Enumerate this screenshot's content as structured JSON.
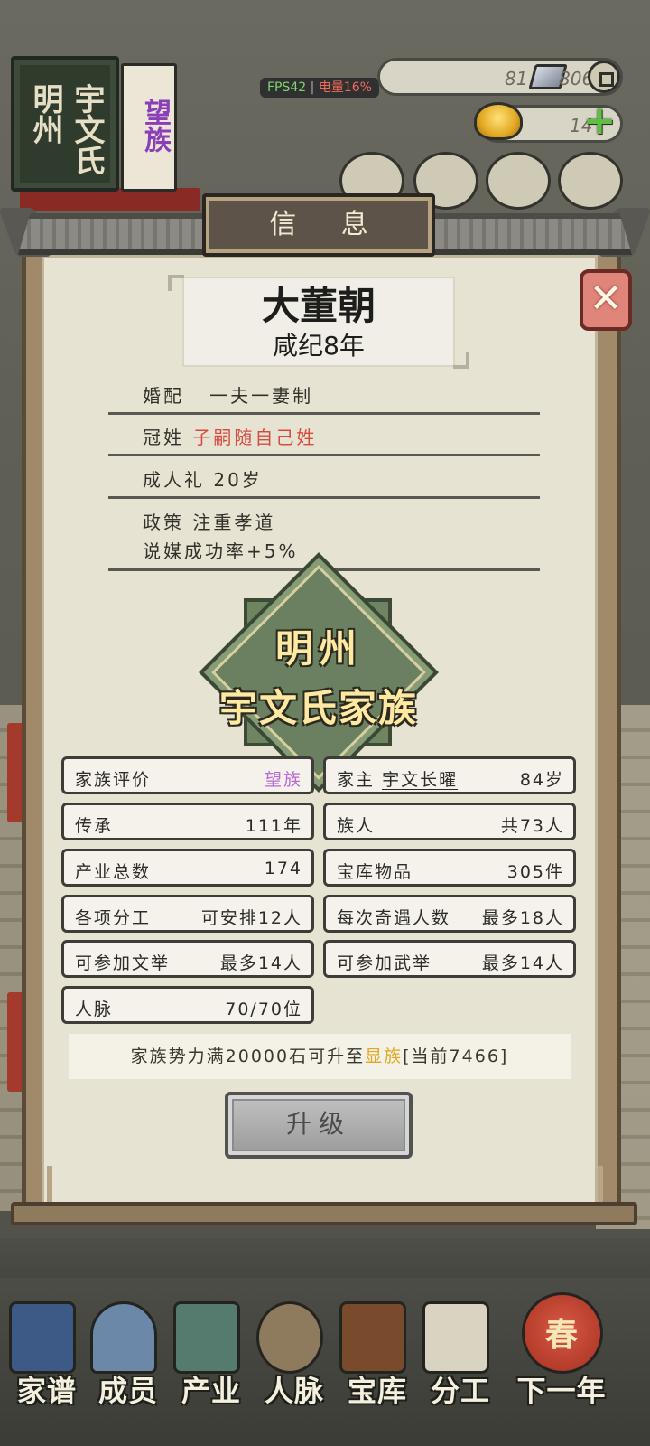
{
  "hud": {
    "book": {
      "col1": "明州",
      "col2": "宇文氏",
      "tag": "望族"
    },
    "fps": "FPS42",
    "battery": "电量16%",
    "silver": "81",
    "coins": "806",
    "gold": "14"
  },
  "panel": {
    "title": "信 息",
    "close_label": "✕",
    "dynasty": "大董朝",
    "year": "咸纪8年",
    "rules": [
      {
        "label": "婚配",
        "value": "一夫一妻制"
      },
      {
        "label": "冠姓",
        "value": "子嗣随自己姓"
      },
      {
        "label": "成人礼",
        "value": "20岁"
      },
      {
        "label": "政策",
        "value": "注重孝道",
        "extra": "说媒成功率+5%"
      }
    ],
    "emblem": {
      "line1": "明州",
      "line2": "宇文氏家族"
    },
    "stats": {
      "rating": {
        "label": "家族评价",
        "value": "望族"
      },
      "head": {
        "label": "家主",
        "name": "宇文长曜",
        "value": "84岁"
      },
      "heritage": {
        "label": "传承",
        "value": "111年"
      },
      "members": {
        "label": "族人",
        "value": "共73人"
      },
      "industry": {
        "label": "产业总数",
        "value": "174"
      },
      "treasury": {
        "label": "宝库物品",
        "value": "305件"
      },
      "division": {
        "label": "各项分工",
        "value": "可安排12人"
      },
      "encounter": {
        "label": "每次奇遇人数",
        "value": "最多18人"
      },
      "civil_exam": {
        "label": "可参加文举",
        "value": "最多14人"
      },
      "military_exam": {
        "label": "可参加武举",
        "value": "最多14人"
      },
      "connections": {
        "label": "人脉",
        "value": "70/70位"
      }
    },
    "note": {
      "pre": "家族势力满20000石可升至",
      "rank": "显族",
      "post": "[当前7466]"
    },
    "upgrade_label": "升级"
  },
  "nav": [
    {
      "label": "家谱",
      "icon": "genealogy-book-icon"
    },
    {
      "label": "成员",
      "icon": "member-portrait-icon"
    },
    {
      "label": "产业",
      "icon": "industry-building-icon"
    },
    {
      "label": "人脉",
      "icon": "network-icon"
    },
    {
      "label": "宝库",
      "icon": "treasure-chest-icon"
    },
    {
      "label": "分工",
      "icon": "scroll-icon"
    },
    {
      "label": "下一年",
      "icon": "spring-lantern-icon",
      "badge": "春"
    }
  ]
}
